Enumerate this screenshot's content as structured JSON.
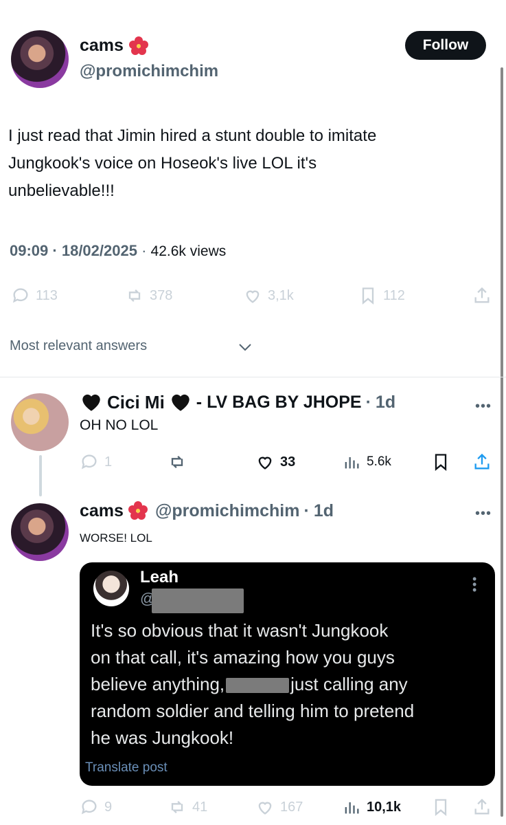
{
  "tweet": {
    "display_name": "cams",
    "handle": "@promichimchim",
    "follow_label": "Follow",
    "text_lines": [
      "I just read that Jimin hired a stunt double to imitate",
      "Jungkook's voice on Hoseok's live LOL it's",
      "unbelievable!!!"
    ],
    "time": "09:09",
    "date": "18/02/2025",
    "views": "42.6k views",
    "stats": {
      "replies": "113",
      "reposts": "378",
      "likes": "3,1k",
      "bookmarks": "112"
    }
  },
  "sort_label": "Most relevant answers",
  "reply1": {
    "display_name": "Cici Mi",
    "suffix": "- LV BAG BY JHOPE",
    "age": "1d",
    "text": "OH NO LOL",
    "stats": {
      "replies": "1",
      "likes": "33",
      "views": "5.6k"
    }
  },
  "reply2": {
    "display_name": "cams",
    "handle": "@promichimchim",
    "age": "1d",
    "text": "WORSE! LOL",
    "stats": {
      "replies": "9",
      "reposts": "41",
      "likes": "167",
      "views": "10,1k"
    }
  },
  "quoted": {
    "name": "Leah",
    "handle_prefix": "@",
    "lines": [
      "It's so obvious that it wasn't Jungkook",
      "on that call, it's amazing how you guys",
      "believe anything,",
      "just calling any",
      "random soldier and telling him to pretend",
      "he was Jungkook!"
    ],
    "translate": "Translate post"
  },
  "colors": {
    "follow_bg": "#0f1419",
    "quote_bg": "#000000",
    "translate": "#1d9bf0"
  }
}
